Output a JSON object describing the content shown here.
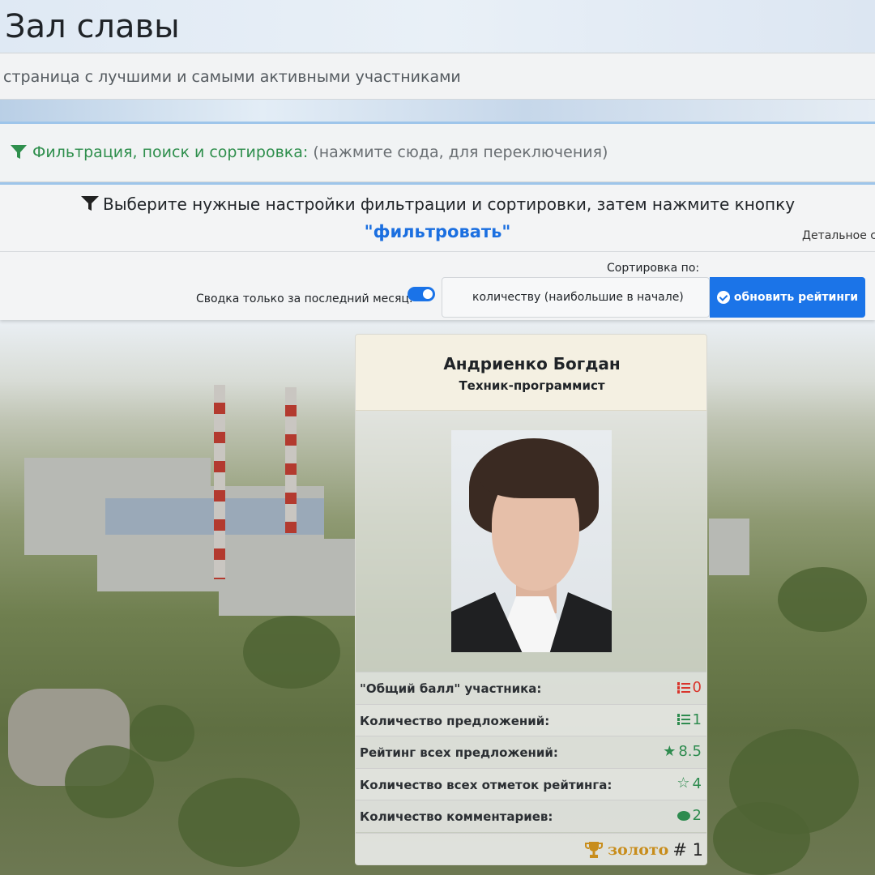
{
  "page": {
    "title": "Зал славы",
    "subtitle": "страница с лучшими и самыми активными участниками"
  },
  "filter_toggle": {
    "label": "Фильтрация, поиск и сортировка:",
    "hint": "(нажмите сюда, для переключения)"
  },
  "filter_panel": {
    "instruction": "Выберите нужные настройки фильтрации и сортировки, затем нажмите кнопку",
    "filter_word": "\"фильтровать\"",
    "detail_link": "Детальное с",
    "sort_label": "Сортировка по:",
    "month_only_label": "Сводка только за последний месяц:",
    "month_only_enabled": true,
    "sort_value": "количеству (наибольшие в начале)",
    "update_button": "обновить рейтинги"
  },
  "card": {
    "name": "Андриенко Богдан",
    "role": "Техник-программист",
    "stats": [
      {
        "label": "\"Общий балл\" участника:",
        "value": "0",
        "icon": "list-icon",
        "color": "#d9342b"
      },
      {
        "label": "Количество предложений:",
        "value": "1",
        "icon": "list-icon",
        "color": "#2e8b4f"
      },
      {
        "label": "Рейтинг всех предложений:",
        "value": "8.5",
        "icon": "star-filled-icon",
        "color": "#2e8b4f"
      },
      {
        "label": "Количество всех отметок рейтинга:",
        "value": "4",
        "icon": "star-outline-icon",
        "color": "#2e8b4f"
      },
      {
        "label": "Количество комментариев:",
        "value": "2",
        "icon": "comment-icon",
        "color": "#2e8b4f"
      }
    ],
    "medal": "золото",
    "rank": "# 1"
  },
  "colors": {
    "accent": "#1b74e8",
    "green": "#2e8b4f",
    "red": "#d9342b",
    "gold": "#c88d1c"
  }
}
